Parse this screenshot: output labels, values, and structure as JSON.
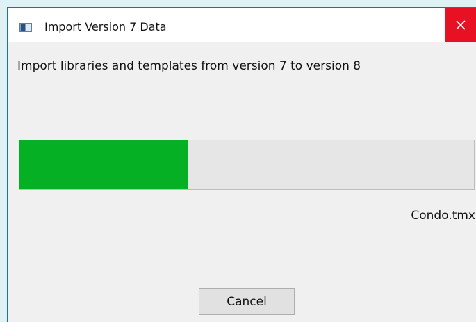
{
  "window": {
    "title": "Import Version 7 Data",
    "icon": "app-window-icon",
    "close_icon": "close-icon"
  },
  "content": {
    "instruction": "Import libraries and templates from version 7 to version 8",
    "progress_fraction": 0.37,
    "current_file": "Condo.tmx"
  },
  "buttons": {
    "cancel_label": "Cancel"
  },
  "colors": {
    "progress_fill": "#06b025",
    "close_button": "#e81123",
    "dialog_background": "#f0f0f0"
  }
}
